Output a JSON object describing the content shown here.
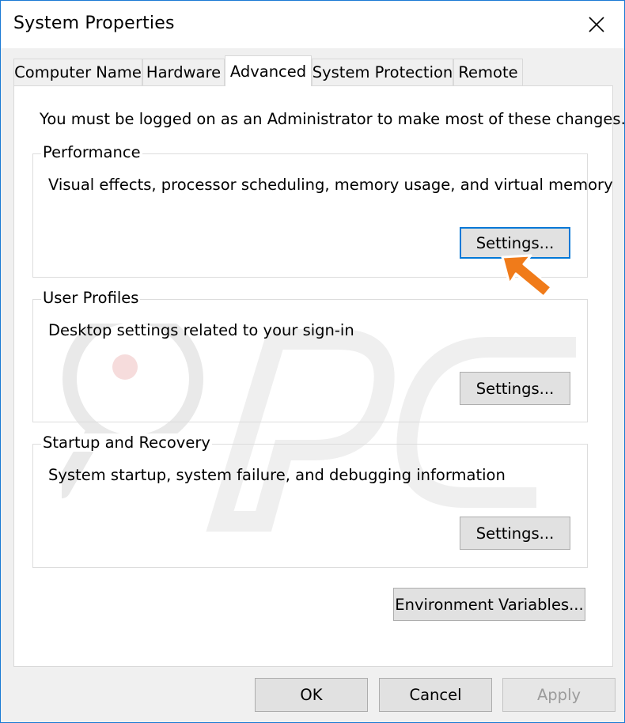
{
  "window": {
    "title": "System Properties"
  },
  "tabs": [
    {
      "label": "Computer Name"
    },
    {
      "label": "Hardware"
    },
    {
      "label": "Advanced"
    },
    {
      "label": "System Protection"
    },
    {
      "label": "Remote"
    }
  ],
  "notice": "You must be logged on as an Administrator to make most of these changes.",
  "performance": {
    "title": "Performance",
    "description": "Visual effects, processor scheduling, memory usage, and virtual memory",
    "button": "Settings..."
  },
  "user_profiles": {
    "title": "User Profiles",
    "description": "Desktop settings related to your sign-in",
    "button": "Settings..."
  },
  "startup_recovery": {
    "title": "Startup and Recovery",
    "description": "System startup, system failure, and debugging information",
    "button": "Settings..."
  },
  "environment_button": "Environment Variables...",
  "footer": {
    "ok": "OK",
    "cancel": "Cancel",
    "apply": "Apply"
  },
  "colors": {
    "accent": "#0078d7",
    "window_border": "#1a7ad4",
    "arrow": "#f07b1a"
  },
  "icons": {
    "close": "close-icon",
    "pointer": "pointer-arrow-icon"
  }
}
